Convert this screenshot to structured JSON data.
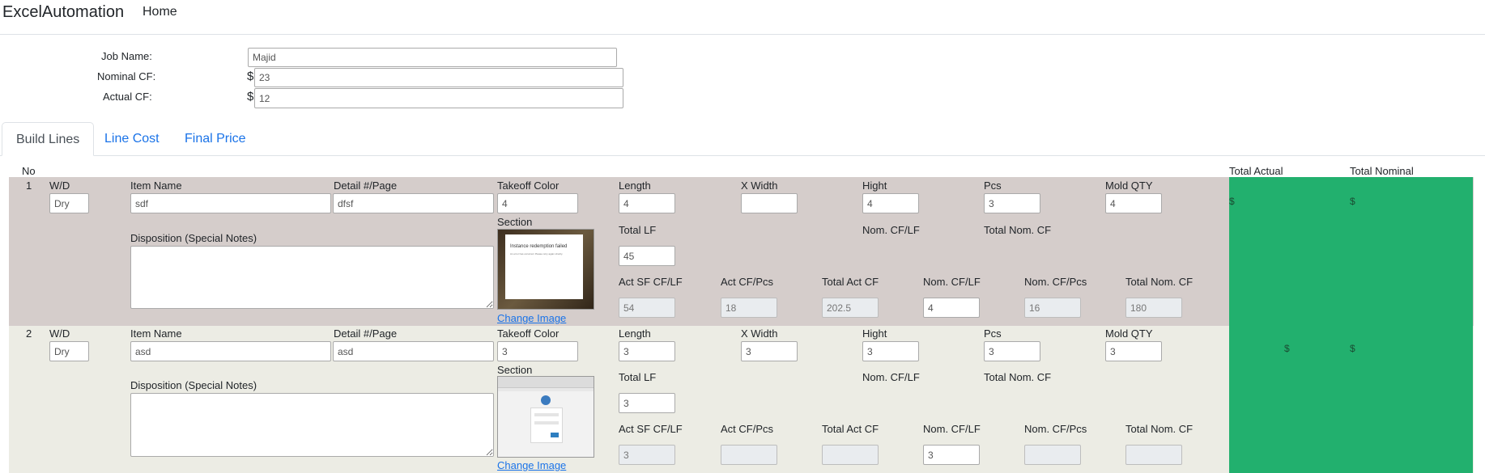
{
  "navbar": {
    "brand": "ExcelAutomation",
    "home": "Home"
  },
  "header_form": {
    "job_name_label": "Job Name:",
    "job_name_value": "Majid",
    "nominal_cf_label": "Nominal CF:",
    "nominal_cf_value": "23",
    "actual_cf_label": "Actual CF:",
    "actual_cf_value": "12",
    "currency": "$"
  },
  "tabs": {
    "build_lines": "Build Lines",
    "line_cost": "Line Cost",
    "final_price": "Final Price"
  },
  "table_headers": {
    "no": "No",
    "total_actual": "Total Actual",
    "total_nominal": "Total Nominal"
  },
  "labels": {
    "wd": "W/D",
    "item_name": "Item Name",
    "detail_page": "Detail #/Page",
    "takeoff_color": "Takeoff Color",
    "length": "Length",
    "x_width": "X Width",
    "hight": "Hight",
    "pcs": "Pcs",
    "mold_qty": "Mold QTY",
    "disposition": "Disposition (Special Notes)",
    "section": "Section",
    "total_lf": "Total LF",
    "nom_cf_lf": "Nom. CF/LF",
    "total_nom_cf": "Total Nom. CF",
    "act_sf_cf_lf": "Act SF CF/LF",
    "act_cf_pcs": "Act CF/Pcs",
    "total_act_cf": "Total Act CF",
    "nom_cf_pcs": "Nom. CF/Pcs",
    "change_image": "Change Image"
  },
  "rows": [
    {
      "no": "1",
      "wd": "Dry",
      "item_name": "sdf",
      "detail_page": "dfsf",
      "takeoff_color": "4",
      "length": "4",
      "x_width": "",
      "hight": "4",
      "pcs": "3",
      "mold_qty": "4",
      "disposition": "",
      "total_lf": "45",
      "act_sf_cf_lf": "54",
      "act_cf_pcs": "18",
      "total_act_cf": "202.5",
      "nom_cf_lf": "4",
      "nom_cf_pcs": "16",
      "total_nom_cf": "180",
      "total_actual": "$",
      "total_nominal": "$",
      "thumb_title": "Instance redemption failed",
      "thumb_text": "An error has occurred. Please retry again shortly."
    },
    {
      "no": "2",
      "wd": "Dry",
      "item_name": "asd",
      "detail_page": "asd",
      "takeoff_color": "3",
      "length": "3",
      "x_width": "3",
      "hight": "3",
      "pcs": "3",
      "mold_qty": "3",
      "disposition": "",
      "total_lf": "3",
      "act_sf_cf_lf": "3",
      "act_cf_pcs": "",
      "total_act_cf": "",
      "nom_cf_lf": "3",
      "nom_cf_pcs": "",
      "total_nom_cf": "",
      "total_actual": "$",
      "total_nominal": "$"
    }
  ]
}
